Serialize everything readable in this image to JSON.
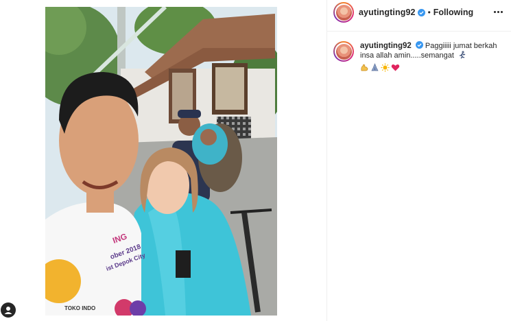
{
  "post": {
    "username": "ayutingting92",
    "follow_status": "Following",
    "separator": "•",
    "caption_user": "ayutingting92",
    "caption_text": "Paggiiiii jumat berkah insa allah amin.....semangat",
    "photo_print": {
      "line1": "ING",
      "line2": "ober 2018",
      "line3": "ist Depok City",
      "footer": "TOKO INDO"
    }
  },
  "icons": {
    "verified": "verified-badge-icon",
    "more": "more-options-icon",
    "runner": "runner-emoji-icon",
    "muscle": "muscle-emoji-icon",
    "pray": "pray-emoji-icon",
    "sun": "sun-emoji-icon",
    "heart": "red-heart-emoji-icon",
    "profile": "profile-icon"
  },
  "colors": {
    "verified": "#3897f0",
    "heart": "#e0245e",
    "divider": "#efefef"
  }
}
